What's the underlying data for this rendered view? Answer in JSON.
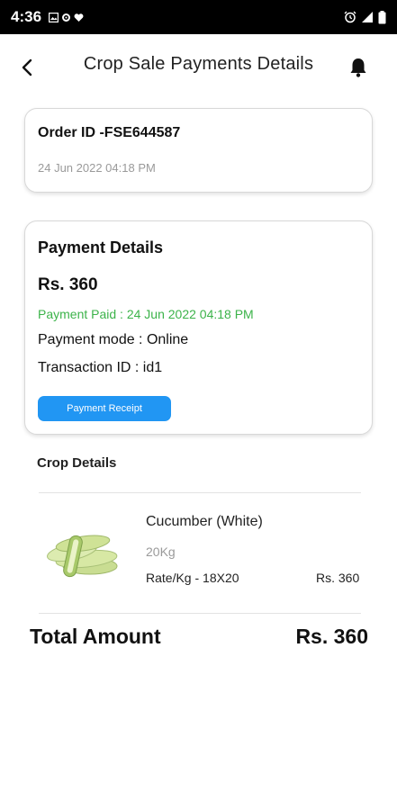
{
  "status_bar": {
    "time": "4:36",
    "left_icons": [
      "gallery-icon",
      "settings-icon",
      "heart-icon"
    ],
    "right_icons": [
      "alarm-icon",
      "signal-icon",
      "battery-icon"
    ]
  },
  "header": {
    "title": "Crop Sale Payments Details",
    "back_icon": "back-arrow-icon",
    "bell_icon": "bell-icon"
  },
  "order": {
    "id_text": "Order ID -FSE644587",
    "date": "24 Jun 2022 04:18 PM"
  },
  "payment": {
    "heading": "Payment Details",
    "amount": "Rs. 360",
    "paid_text": "Payment Paid : 24 Jun 2022 04:18 PM",
    "mode_text": "Payment mode : Online",
    "transaction_text": "Transaction ID : id1",
    "receipt_button": "Payment Receipt",
    "accent_color": "#2196f3",
    "paid_color": "#3cb34a"
  },
  "crop": {
    "heading": "Crop Details",
    "items": [
      {
        "name": "Cucumber (White)",
        "quantity": "20Kg",
        "rate": "Rate/Kg - 18X20",
        "price": "Rs. 360",
        "image_icon": "cucumber-image"
      }
    ]
  },
  "total": {
    "label": "Total Amount",
    "value": "Rs. 360"
  }
}
